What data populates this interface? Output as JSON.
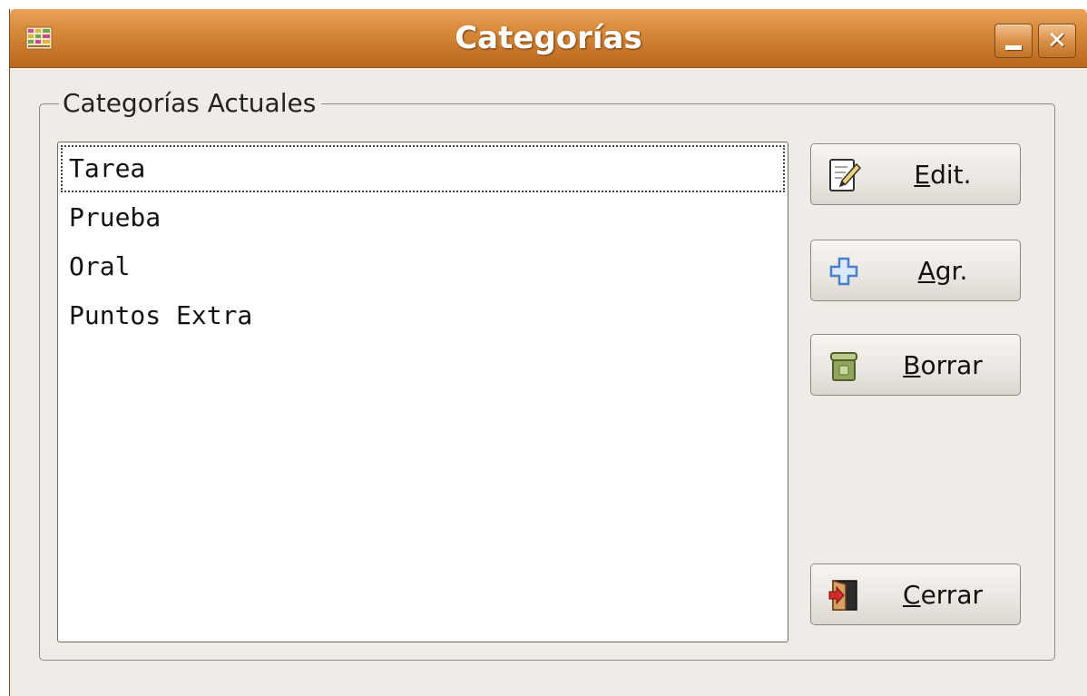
{
  "window": {
    "title": "Categorías",
    "minimize_symbol": "_",
    "close_symbol": "✕"
  },
  "frame": {
    "label": "Categorías Actuales"
  },
  "categories": {
    "items": [
      "Tarea",
      "Prueba",
      "Oral",
      "Puntos Extra"
    ],
    "focused_index": 0
  },
  "buttons": {
    "edit": {
      "mnemonic": "E",
      "rest": "dit.",
      "icon": "edit-document-icon"
    },
    "add": {
      "mnemonic": "A",
      "rest": "gr.",
      "icon": "add-plus-icon"
    },
    "delete": {
      "mnemonic": "B",
      "rest": "orrar",
      "icon": "trash-bin-icon"
    },
    "close": {
      "mnemonic": "C",
      "rest": "errar",
      "icon": "exit-door-icon"
    }
  },
  "colors": {
    "titlebar": "#d98b3c",
    "window_bg": "#efebe7",
    "add_icon": "#4a7fc9"
  }
}
